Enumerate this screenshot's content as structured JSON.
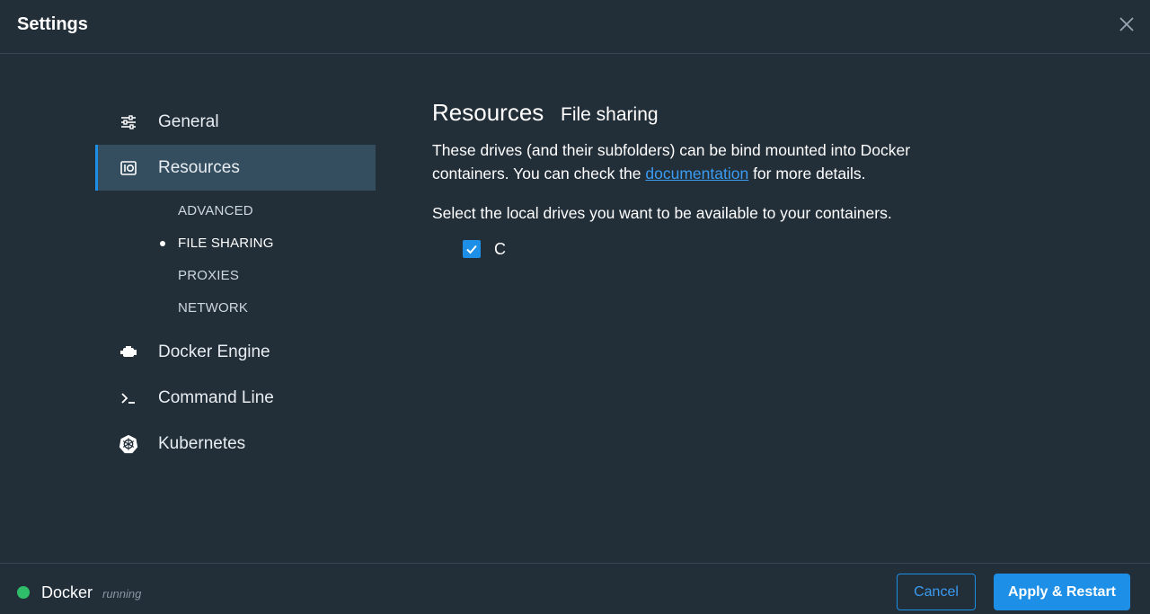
{
  "window": {
    "title": "Settings",
    "close_icon": "close-icon"
  },
  "sidebar": {
    "items": [
      {
        "label": "General",
        "icon": "sliders-icon",
        "active": false
      },
      {
        "label": "Resources",
        "icon": "resources-icon",
        "active": true
      },
      {
        "label": "Docker Engine",
        "icon": "engine-icon",
        "active": false
      },
      {
        "label": "Command Line",
        "icon": "terminal-icon",
        "active": false
      },
      {
        "label": "Kubernetes",
        "icon": "kubernetes-icon",
        "active": false
      }
    ],
    "subitems": [
      {
        "label": "ADVANCED",
        "active": false
      },
      {
        "label": "FILE SHARING",
        "active": true
      },
      {
        "label": "PROXIES",
        "active": false
      },
      {
        "label": "NETWORK",
        "active": false
      }
    ]
  },
  "main": {
    "title": "Resources",
    "subtitle": "File sharing",
    "description_before": "These drives (and their subfolders) can be bind mounted into Docker containers. You can check the ",
    "description_link": "documentation",
    "description_after": " for more details.",
    "prompt": "Select the local drives you want to be available to your containers.",
    "drives": [
      {
        "label": "C",
        "checked": true
      }
    ]
  },
  "footer": {
    "status_name": "Docker",
    "status_text": "running",
    "status_color": "#2fbd6a",
    "cancel_label": "Cancel",
    "apply_label": "Apply & Restart"
  },
  "colors": {
    "background": "#222e38",
    "accent": "#1d8fe6",
    "active_item_bg": "#344d5f",
    "link": "#3b9cf2"
  }
}
